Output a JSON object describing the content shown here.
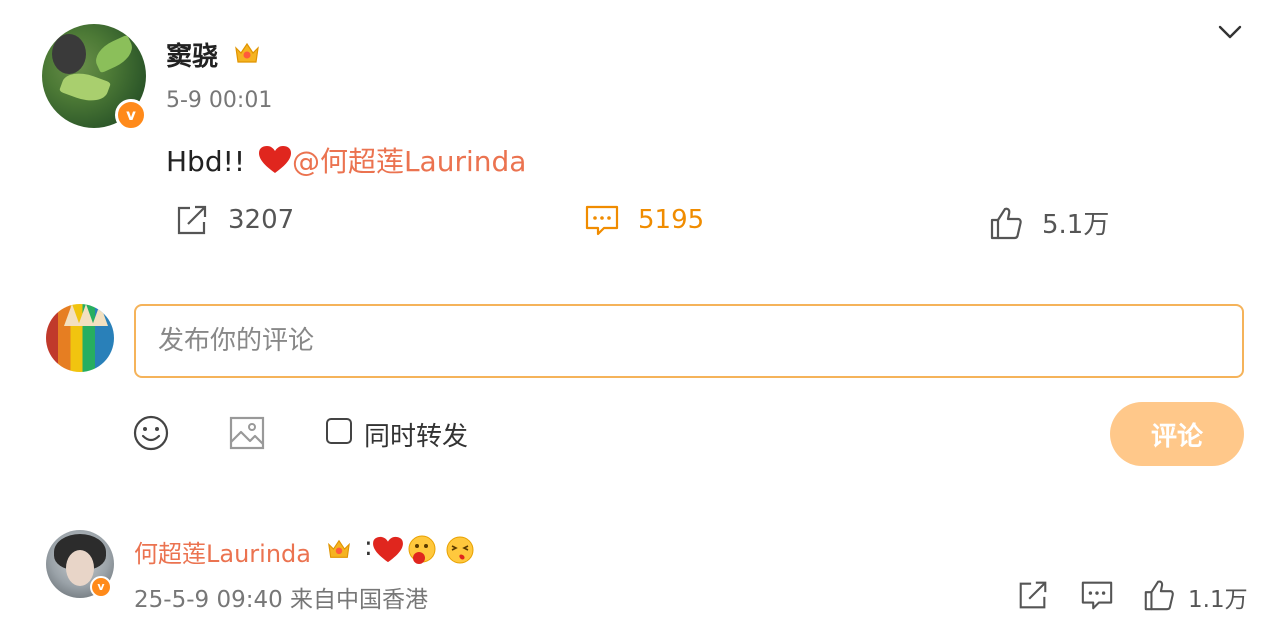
{
  "post": {
    "username": "窦骁",
    "timestamp": "5-9 00:01",
    "body_text": "Hbd!! ",
    "mention": "@何超莲Laurinda",
    "verify_badge": "v",
    "icons": {
      "expand": "chevron-down-icon",
      "badge": "crown-icon",
      "verified": "verified-badge-icon",
      "emoji": "red-heart-icon"
    }
  },
  "actions": {
    "repost_count": "3207",
    "comment_count": "5195",
    "like_count": "5.1万",
    "icons": {
      "repost": "share-icon",
      "comment": "comment-icon",
      "like": "thumbs-up-icon"
    },
    "active_color": "#f08c00"
  },
  "composer": {
    "placeholder": "发布你的评论",
    "value": "",
    "repost_label": "同时转发",
    "repost_checked": false,
    "submit_label": "评论",
    "icons": {
      "emoji": "smiley-icon",
      "image": "image-icon"
    },
    "border_color": "#f5b35a",
    "submit_color": "#ffc88a"
  },
  "reply": {
    "username": "何超莲Laurinda",
    "colon": ":",
    "meta": "25-5-9 09:40 来自中国香港",
    "like_count": "1.1万",
    "icons": {
      "share": "share-icon",
      "comment": "comment-icon",
      "like": "thumbs-up-icon",
      "emojis": [
        "red-heart-icon",
        "thinking-face-icon",
        "blowing-kiss-face-icon"
      ]
    }
  },
  "colors": {
    "mention": "#eb7350",
    "verified": "#ff8a1a"
  }
}
